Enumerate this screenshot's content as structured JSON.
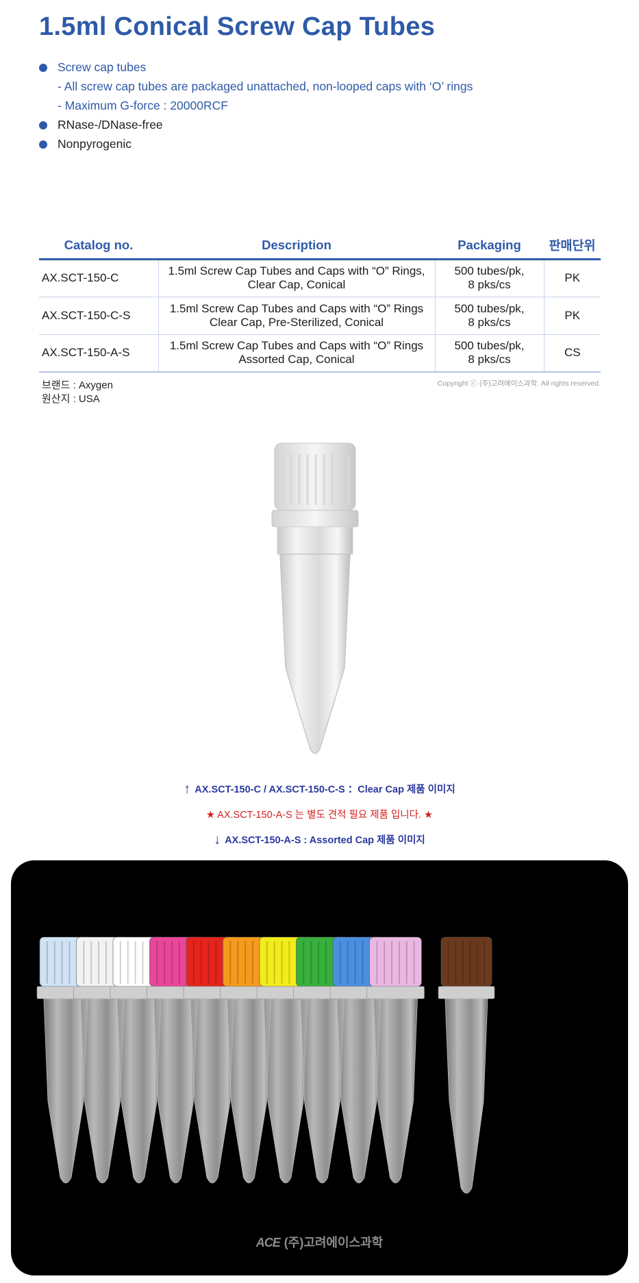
{
  "title": "1.5ml Conical Screw Cap Tubes",
  "features": {
    "item1": "Screw cap tubes",
    "sub1": "- All screw cap tubes are packaged unattached, non-looped caps with ‘O’ rings",
    "sub2": "- Maximum G-force : 20000RCF",
    "item2": "RNase-/DNase-free",
    "item3": "Nonpyrogenic"
  },
  "table": {
    "headers": [
      "Catalog no.",
      "Description",
      "Packaging",
      "판매단위"
    ],
    "rows": [
      {
        "catalog": "AX.SCT-150-C",
        "desc1": "1.5ml Screw Cap Tubes and Caps with “O” Rings,",
        "desc2": "Clear Cap, Conical",
        "pack1": "500 tubes/pk,",
        "pack2": "8 pks/cs",
        "unit": "PK"
      },
      {
        "catalog": "AX.SCT-150-C-S",
        "desc1": "1.5ml Screw Cap Tubes and Caps with “O” Rings",
        "desc2": "Clear Cap, Pre-Sterilized, Conical",
        "pack1": "500 tubes/pk,",
        "pack2": "8 pks/cs",
        "unit": "PK"
      },
      {
        "catalog": "AX.SCT-150-A-S",
        "desc1": "1.5ml Screw Cap Tubes and Caps with “O” Rings",
        "desc2": "Assorted Cap, Conical",
        "pack1": "500 tubes/pk,",
        "pack2": "8 pks/cs",
        "unit": "CS"
      }
    ]
  },
  "meta": {
    "brand": "브랜드 : Axygen",
    "origin": "원산지 : USA",
    "copyright": "Copyright ⓒ (주)고려에이스과학. All rights reserved."
  },
  "captions": {
    "up_arrow": "↑",
    "clear": "AX.SCT-150-C / AX.SCT-150-C-S ：Clear Cap 제품 이미지",
    "notice": "★ AX.SCT-150-A-S 는 별도 견적 필요 제품 입니다. ★",
    "down_arrow": "↓",
    "assorted": "AX.SCT-150-A-S : Assorted Cap 제품 이미지"
  },
  "logo": {
    "mark": "ACE",
    "text": "(주)고려에이스과학"
  },
  "cap_colors": [
    "#cfe3f5",
    "#f2f2f2",
    "#ffffff",
    "#e8469a",
    "#e5241b",
    "#f59a1b",
    "#f3ec1c",
    "#37b03d",
    "#4a8fe0",
    "#eab7e2",
    "#6b3a1e"
  ],
  "colors": {
    "brand_blue": "#2f5aa8",
    "caption_navy": "#2a3aa0",
    "notice_red": "#d42020"
  }
}
